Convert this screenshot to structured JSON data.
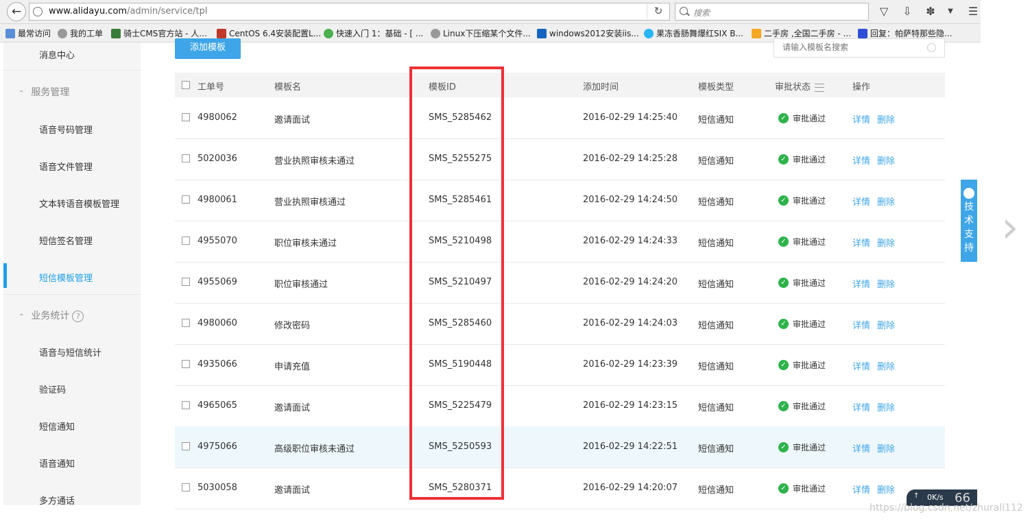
{
  "browser": {
    "url_host": "www.alidayu.com",
    "url_path": "/admin/service/tpl",
    "search_placeholder": "搜索",
    "bookmarks": [
      {
        "label": "最常访问"
      },
      {
        "label": "我的工单"
      },
      {
        "label": "骑士CMS官方站 - 人..."
      },
      {
        "label": "CentOS 6.4安装配置L..."
      },
      {
        "label": "快速入门 1：基础 - [ ..."
      },
      {
        "label": "Linux下压缩某个文件..."
      },
      {
        "label": "windows2012安装iis..."
      },
      {
        "label": "果冻香肠舞爆红SIX B..."
      },
      {
        "label": "二手房 ,全国二手房 - ..."
      },
      {
        "label": "回复：帕萨特那些隐..."
      }
    ]
  },
  "sidebar": {
    "top_item": "消息中心",
    "group_service": "服务管理",
    "service_items": [
      "语音号码管理",
      "语音文件管理",
      "文本转语音模板管理",
      "短信签名管理",
      "短信模板管理"
    ],
    "group_stats": "业务统计",
    "help_symbol": "?",
    "stats_items": [
      "语音与短信统计",
      "验证码",
      "短信通知",
      "语音通知",
      "多方通话"
    ]
  },
  "toolbar": {
    "add_button": "添加模板",
    "search_placeholder": "请输入模板名搜索"
  },
  "table": {
    "headers": {
      "order_no": "工单号",
      "name": "模板名",
      "template_id": "模板ID",
      "added_time": "添加时间",
      "type": "模板类型",
      "status": "审批状态",
      "actions": "操作"
    },
    "detail_label": "详情",
    "delete_label": "删除",
    "rows": [
      {
        "order_no": "4980062",
        "name": "邀请面试",
        "template_id": "SMS_5285462",
        "added_time": "2016-02-29 14:25:40",
        "type": "短信通知",
        "status": "审批通过"
      },
      {
        "order_no": "5020036",
        "name": "营业执照审核未通过",
        "template_id": "SMS_5255275",
        "added_time": "2016-02-29 14:25:28",
        "type": "短信通知",
        "status": "审批通过"
      },
      {
        "order_no": "4980061",
        "name": "营业执照审核通过",
        "template_id": "SMS_5285461",
        "added_time": "2016-02-29 14:24:50",
        "type": "短信通知",
        "status": "审批通过"
      },
      {
        "order_no": "4955070",
        "name": "职位审核未通过",
        "template_id": "SMS_5210498",
        "added_time": "2016-02-29 14:24:33",
        "type": "短信通知",
        "status": "审批通过"
      },
      {
        "order_no": "4955069",
        "name": "职位审核通过",
        "template_id": "SMS_5210497",
        "added_time": "2016-02-29 14:24:20",
        "type": "短信通知",
        "status": "审批通过"
      },
      {
        "order_no": "4980060",
        "name": "修改密码",
        "template_id": "SMS_5285460",
        "added_time": "2016-02-29 14:24:03",
        "type": "短信通知",
        "status": "审批通过"
      },
      {
        "order_no": "4935066",
        "name": "申请充值",
        "template_id": "SMS_5190448",
        "added_time": "2016-02-29 14:23:39",
        "type": "短信通知",
        "status": "审批通过"
      },
      {
        "order_no": "4965065",
        "name": "邀请面试",
        "template_id": "SMS_5225479",
        "added_time": "2016-02-29 14:23:15",
        "type": "短信通知",
        "status": "审批通过"
      },
      {
        "order_no": "4975066",
        "name": "高级职位审核未通过",
        "template_id": "SMS_5250593",
        "added_time": "2016-02-29 14:22:51",
        "type": "短信通知",
        "status": "审批通过"
      },
      {
        "order_no": "5030058",
        "name": "邀请面试",
        "template_id": "SMS_5280371",
        "added_time": "2016-02-29 14:20:07",
        "type": "短信通知",
        "status": "审批通过"
      }
    ]
  },
  "widgets": {
    "tech_support": [
      "技",
      "术",
      "支",
      "持"
    ],
    "speed_text": "0K/s",
    "speed_num": "66",
    "watermark": "https://blog.csdn.net/zhurall112"
  },
  "colors": {
    "accent": "#3ea6e8",
    "highlight_border": "#ee3035",
    "status_ok": "#2db34a"
  }
}
